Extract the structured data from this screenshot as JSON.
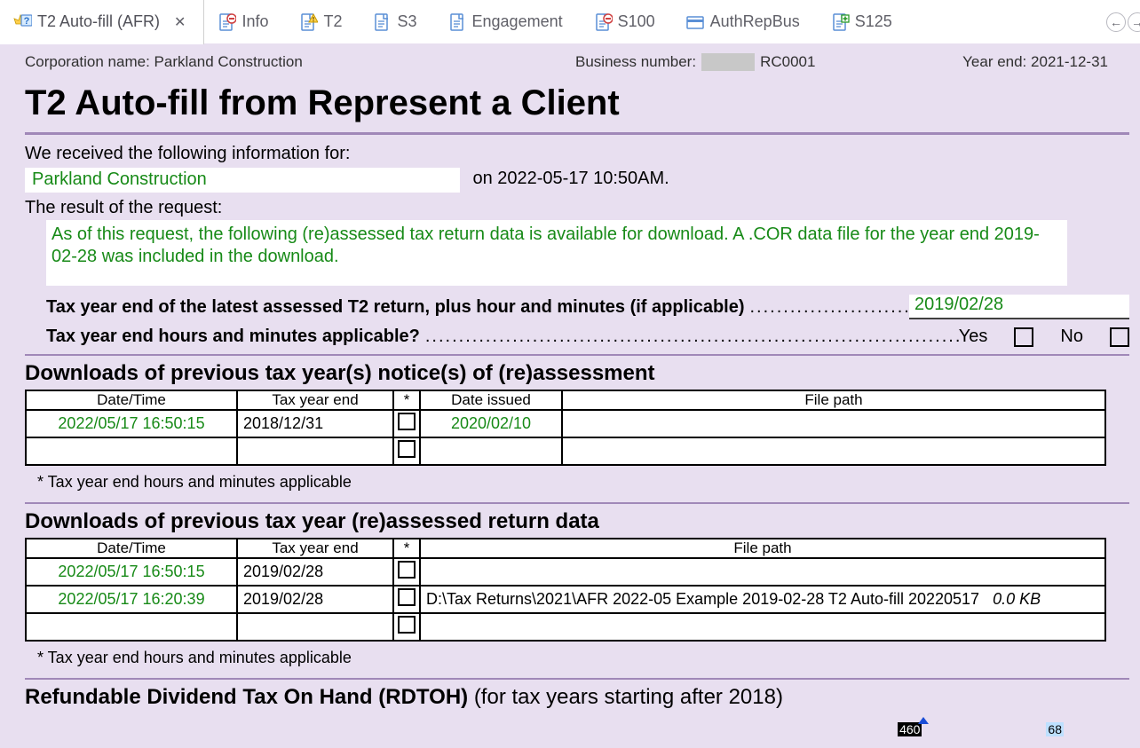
{
  "tabs": [
    {
      "label": "T2 Auto-fill (AFR)",
      "active": true,
      "icon": "star-q",
      "closeable": true
    },
    {
      "label": "Info",
      "icon": "doc-minus"
    },
    {
      "label": "T2",
      "icon": "doc-warn"
    },
    {
      "label": "S3",
      "icon": "doc"
    },
    {
      "label": "Engagement",
      "icon": "doc"
    },
    {
      "label": "S100",
      "icon": "doc-minus"
    },
    {
      "label": "AuthRepBus",
      "icon": "card"
    },
    {
      "label": "S125",
      "icon": "doc-plus"
    }
  ],
  "header": {
    "corp_label": "Corporation name:",
    "corp_name": "Parkland Construction",
    "bn_label": "Business number:",
    "bn_suffix": "RC0001",
    "yearend_label": "Year end:",
    "yearend_value": "2021-12-31"
  },
  "title": "T2 Auto-fill from Represent a Client",
  "intro": {
    "line1": "We received the following information for:",
    "corp": "Parkland Construction",
    "after": "on 2022-05-17 10:50AM.",
    "result_label": "The result of the request:",
    "result_text": "As of this request, the following (re)assessed tax return data is available for download. A .COR data file for the year end 2019-02-28 was included in the download."
  },
  "fields": {
    "latest_label": "Tax year end of the latest assessed T2 return, plus hour and minutes (if applicable)",
    "latest_value": "2019/02/28",
    "hm_label": "Tax year end hours and minutes applicable?",
    "yes": "Yes",
    "no": "No"
  },
  "section1": {
    "heading": "Downloads of previous tax year(s) notice(s) of (re)assessment",
    "cols": {
      "c1": "Date/Time",
      "c2": "Tax year end",
      "c3": "*",
      "c4": "Date issued",
      "c5": "File path"
    },
    "rows": [
      {
        "dt": "2022/05/17 16:50:15",
        "tye": "2018/12/31",
        "issued": "2020/02/10",
        "path": ""
      },
      {
        "dt": "",
        "tye": "",
        "issued": "",
        "path": ""
      }
    ],
    "footnote": "* Tax year end hours and minutes applicable"
  },
  "section2": {
    "heading": "Downloads of previous tax year (re)assessed return data",
    "cols": {
      "c1": "Date/Time",
      "c2": "Tax year end",
      "c3": "*",
      "c4": "File path"
    },
    "rows": [
      {
        "dt": "2022/05/17 16:50:15",
        "tye": "2019/02/28",
        "path": "",
        "size": ""
      },
      {
        "dt": "2022/05/17 16:20:39",
        "tye": "2019/02/28",
        "path": "D:\\Tax Returns\\2021\\AFR 2022-05 Example 2019-02-28 T2 Auto-fill 20220517",
        "size": "0.0 KB"
      },
      {
        "dt": "",
        "tye": "",
        "path": "",
        "size": ""
      }
    ],
    "footnote": "* Tax year end hours and minutes applicable"
  },
  "rdtoh": {
    "heading": "Refundable Dividend Tax On Hand (RDTOH)",
    "paren": "(for tax years starting after 2018)",
    "box1": "460",
    "box2": "68"
  }
}
